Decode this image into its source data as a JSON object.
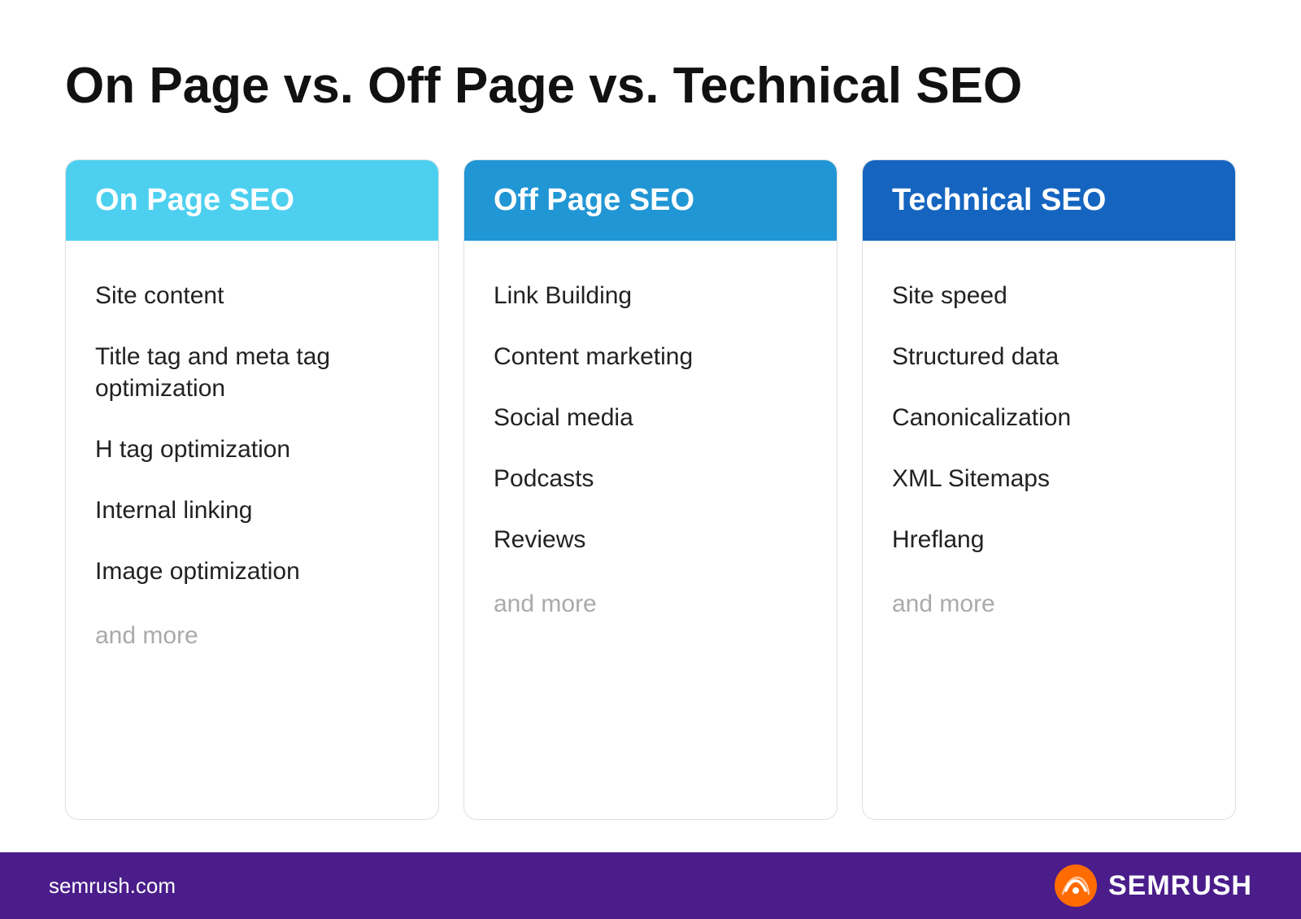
{
  "page": {
    "title": "On Page vs. Off Page vs. Technical SEO"
  },
  "cards": [
    {
      "id": "on-page",
      "header": "On Page SEO",
      "header_class": "on-page",
      "items": [
        "Site content",
        "Title tag and meta tag optimization",
        "H tag optimization",
        "Internal linking",
        "Image optimization"
      ],
      "more": "and more"
    },
    {
      "id": "off-page",
      "header": "Off Page SEO",
      "header_class": "off-page",
      "items": [
        "Link Building",
        "Content marketing",
        "Social media",
        "Podcasts",
        "Reviews"
      ],
      "more": "and more"
    },
    {
      "id": "technical",
      "header": "Technical SEO",
      "header_class": "technical",
      "items": [
        "Site speed",
        "Structured data",
        "Canonicalization",
        "XML Sitemaps",
        "Hreflang"
      ],
      "more": "and more"
    }
  ],
  "footer": {
    "url": "semrush.com",
    "brand": "SEMRUSH"
  }
}
